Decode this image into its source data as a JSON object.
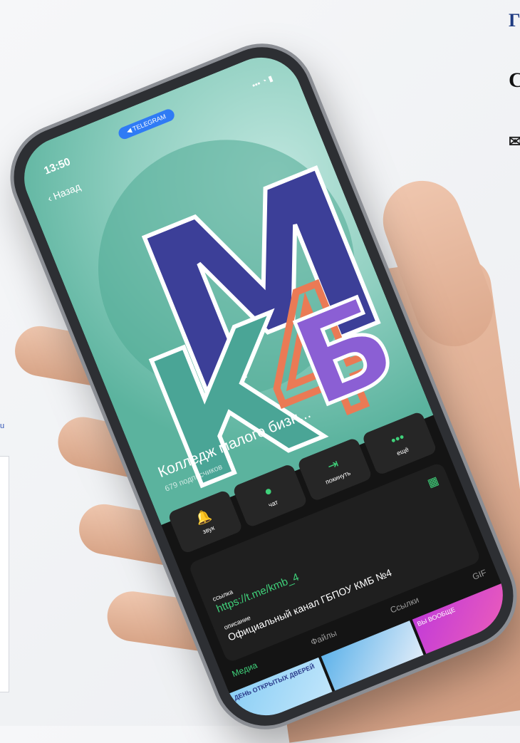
{
  "page": {
    "edge_title_fragment": "Г",
    "edge_text_fragment": "С",
    "edge_small_fragment": "u",
    "accent_color": "#1f3b82"
  },
  "phone_screen": {
    "status_time": "13:50",
    "status_right": "▪▪▪ ◔ ▮",
    "telegram_pill": "◀ TELEGRAM",
    "back_label": "Назад",
    "logo_letters": [
      "К",
      "М",
      "4",
      "Б"
    ],
    "channel_title": "Колледж малого бизн...",
    "subscribers": "679 подписчиков",
    "actions": [
      {
        "label": "звук",
        "icon": "bell-icon",
        "glyph": "🔔"
      },
      {
        "label": "чат",
        "icon": "chat-icon",
        "glyph": "●"
      },
      {
        "label": "покинуть",
        "icon": "leave-icon",
        "glyph": "⇥"
      },
      {
        "label": "ещё",
        "icon": "more-icon",
        "glyph": "•••"
      }
    ],
    "info": {
      "link_label": "ссылка",
      "link_value": "https://t.me/kmb_4",
      "desc_label": "описание",
      "desc_value": "Официальный канал ГБПОУ КМБ №4"
    },
    "tabs": [
      "Медиа",
      "Файлы",
      "Ссылки",
      "GIF"
    ],
    "thumbnails": [
      "ДЕНЬ ОТКРЫТЫХ ДВЕРЕЙ",
      "",
      "ВЫ ВООБЩЕ"
    ],
    "accent_green": "#3fd17a",
    "logo_colors": {
      "k": "#4aa596",
      "m": "#3c3f98",
      "four": "#ea7a55",
      "b": "#8b5fd4"
    }
  }
}
